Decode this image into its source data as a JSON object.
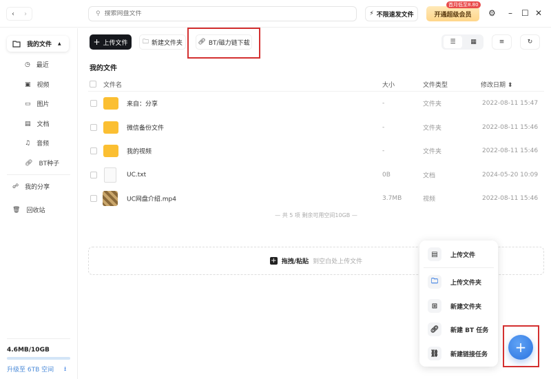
{
  "top": {
    "search_placeholder": "搜索网盘文件",
    "speed_label": "不限速发文件",
    "vip_label": "开通超级会员",
    "vip_badge": "首月低至8.80"
  },
  "sidebar": {
    "my_files": "我的文件",
    "items": [
      {
        "label": "最近"
      },
      {
        "label": "视频"
      },
      {
        "label": "图片"
      },
      {
        "label": "文档"
      },
      {
        "label": "音频"
      },
      {
        "label": "BT种子"
      }
    ],
    "share": "我的分享",
    "trash": "回收站",
    "usage": "4.6MB/10GB",
    "usage_fraction": 0.00046,
    "upgrade": "升级至 6TB 空间"
  },
  "toolbar": {
    "upload": "上传文件",
    "new_folder": "新建文件夹",
    "bt": "BT/磁力链下载"
  },
  "main": {
    "title": "我的文件",
    "headers": {
      "name": "文件名",
      "size": "大小",
      "type": "文件类型",
      "date": "修改日期"
    },
    "files": [
      {
        "name": "来自：分享",
        "size": "-",
        "type": "文件夹",
        "date": "2022-08-11 15:47",
        "kind": "folder"
      },
      {
        "name": "微信备份文件",
        "size": "-",
        "type": "文件夹",
        "date": "2022-08-11 15:46",
        "kind": "folder"
      },
      {
        "name": "我的视频",
        "size": "-",
        "type": "文件夹",
        "date": "2022-08-11 15:46",
        "kind": "folder"
      },
      {
        "name": "UC.txt",
        "size": "0B",
        "type": "文档",
        "date": "2024-05-20 10:09",
        "kind": "doc"
      },
      {
        "name": "UC网盘介绍.mp4",
        "size": "3.7MB",
        "type": "视频",
        "date": "2022-08-11 15:46",
        "kind": "video"
      }
    ],
    "summary": "— 共 5 项 剩余可用空间10GB —",
    "drop_label": "拖拽/粘贴",
    "drop_hint": "到空白处上传文件"
  },
  "menu": {
    "items": [
      {
        "label": "上传文件"
      },
      {
        "label": "上传文件夹"
      },
      {
        "label": "新建文件夹"
      },
      {
        "label": "新建 BT 任务"
      },
      {
        "label": "新建链接任务"
      }
    ]
  },
  "colors": {
    "accent": "#2b74e0",
    "highlight": "#d32f2f"
  }
}
